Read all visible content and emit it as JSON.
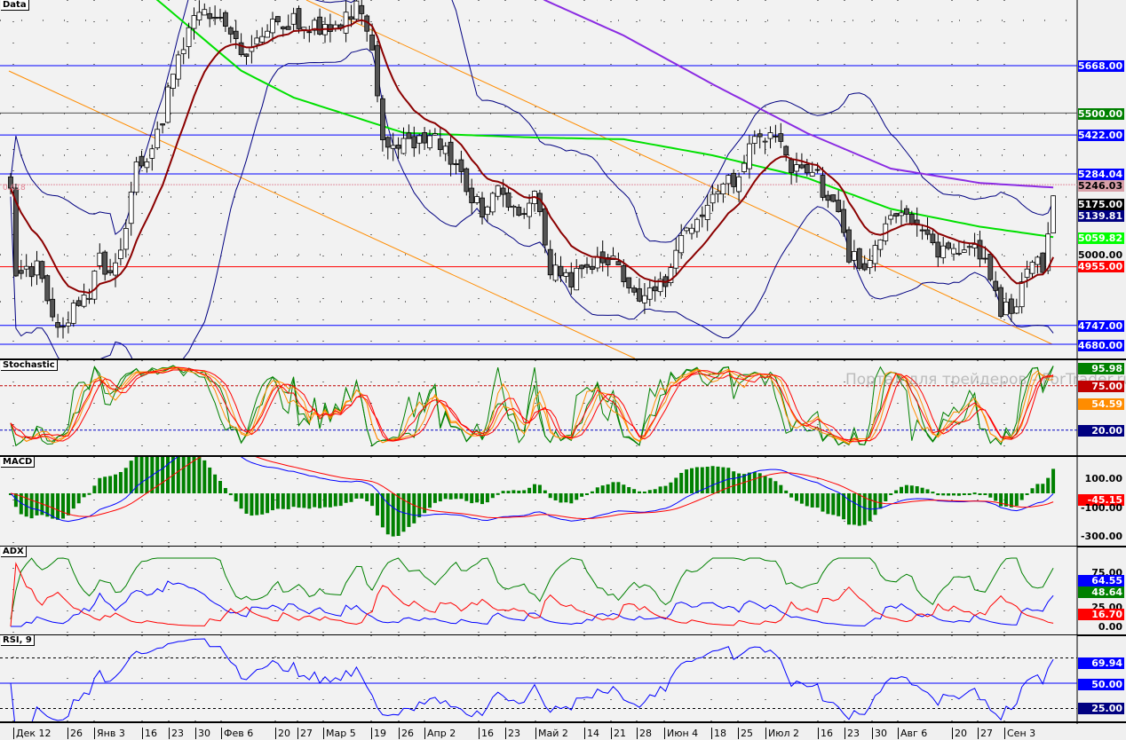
{
  "panels": {
    "main": "Data",
    "stoch": "Stochastic",
    "macd": "MACD",
    "adx": "ADX",
    "rsi": "RSI, 9"
  },
  "watermark": "Портал для трейдеров - ForTrader.ru",
  "fib_label": "0.618",
  "axis_labels": {
    "main": [
      {
        "text": "5668.00",
        "style": "blue"
      },
      {
        "text": "5500.00",
        "style": "green"
      },
      {
        "text": "5422.00",
        "style": "blue"
      },
      {
        "text": "5284.04",
        "style": "blue"
      },
      {
        "text": "5246.03",
        "style": "pink"
      },
      {
        "text": "5175.00",
        "style": "black"
      },
      {
        "text": "5139.81",
        "style": "navy"
      },
      {
        "text": "5059.82",
        "style": "lime"
      },
      {
        "text": "5000.00",
        "style": "plain"
      },
      {
        "text": "4955.00",
        "style": "red"
      },
      {
        "text": "4747.00",
        "style": "blue"
      },
      {
        "text": "4680.00",
        "style": "blue"
      }
    ],
    "stoch": [
      {
        "text": "95.98",
        "style": "green"
      },
      {
        "text": "75.00",
        "style": "dred"
      },
      {
        "text": "54.59",
        "style": "orange"
      },
      {
        "text": "20.00",
        "style": "navy"
      }
    ],
    "macd": [
      {
        "text": "100.00",
        "style": "plain"
      },
      {
        "text": "-45.15",
        "style": "red"
      },
      {
        "text": "-100.00",
        "style": "plain"
      },
      {
        "text": "-300.00",
        "style": "plain"
      }
    ],
    "adx": [
      {
        "text": "75.00",
        "style": "plain"
      },
      {
        "text": "64.55",
        "style": "blue"
      },
      {
        "text": "48.64",
        "style": "green"
      },
      {
        "text": "25.00",
        "style": "plain"
      },
      {
        "text": "16.70",
        "style": "red"
      },
      {
        "text": "0.00",
        "style": "plain"
      }
    ],
    "rsi": [
      {
        "text": "69.94",
        "style": "blue"
      },
      {
        "text": "50.00",
        "style": "blue"
      },
      {
        "text": "25.00",
        "style": "navy"
      }
    ]
  },
  "dates": [
    "Дек 12",
    "26",
    "Янв 3",
    "16",
    "23",
    "30",
    "Фев 6",
    "20",
    "27",
    "Мар 5",
    "19",
    "26",
    "Апр 2",
    "16",
    "23",
    "Май 2",
    "14",
    "21",
    "28",
    "Июн 4",
    "18",
    "25",
    "Июл 2",
    "16",
    "23",
    "30",
    "Авг 6",
    "20",
    "27",
    "Сен 3"
  ],
  "colors": {
    "ma_fast": "#8b0000",
    "ma_mid": "#00e000",
    "ma_slow": "#8a2be2",
    "bands": "#000080",
    "channel": "#ff8c00",
    "level": "#0000ff",
    "support_red": "#ff0000"
  },
  "chart_data": {
    "type": "candlestick",
    "title": "Data",
    "bars": 200,
    "close_keypoints": [
      [
        0,
        5200
      ],
      [
        1,
        4900
      ],
      [
        5,
        4950
      ],
      [
        9,
        4760
      ],
      [
        14,
        4830
      ],
      [
        17,
        4970
      ],
      [
        20,
        4950
      ],
      [
        24,
        5300
      ],
      [
        28,
        5420
      ],
      [
        32,
        5700
      ],
      [
        35,
        5820
      ],
      [
        39,
        5870
      ],
      [
        44,
        5700
      ],
      [
        49,
        5820
      ],
      [
        56,
        5830
      ],
      [
        61,
        5780
      ],
      [
        66,
        5880
      ],
      [
        69,
        5700
      ],
      [
        71,
        5400
      ],
      [
        75,
        5380
      ],
      [
        80,
        5440
      ],
      [
        85,
        5300
      ],
      [
        90,
        5150
      ],
      [
        93,
        5230
      ],
      [
        97,
        5120
      ],
      [
        100,
        5200
      ],
      [
        103,
        4950
      ],
      [
        107,
        4900
      ],
      [
        110,
        4950
      ],
      [
        115,
        4980
      ],
      [
        120,
        4810
      ],
      [
        125,
        4900
      ],
      [
        129,
        5100
      ],
      [
        132,
        5160
      ],
      [
        136,
        5250
      ],
      [
        139,
        5270
      ],
      [
        142,
        5420
      ],
      [
        146,
        5420
      ],
      [
        149,
        5310
      ],
      [
        154,
        5270
      ],
      [
        158,
        5120
      ],
      [
        160,
        4980
      ],
      [
        163,
        4970
      ],
      [
        166,
        5060
      ],
      [
        171,
        5170
      ],
      [
        176,
        5030
      ],
      [
        181,
        5000
      ],
      [
        186,
        5000
      ],
      [
        189,
        4800
      ],
      [
        192,
        4790
      ],
      [
        194,
        4960
      ],
      [
        197,
        4960
      ],
      [
        199,
        5175
      ]
    ],
    "ma_mid_keypoints": [
      [
        20,
        6050
      ],
      [
        28,
        5901
      ],
      [
        44,
        5650
      ],
      [
        54,
        5555
      ],
      [
        75,
        5430
      ],
      [
        100,
        5413
      ],
      [
        117,
        5407
      ],
      [
        134,
        5350
      ],
      [
        152,
        5270
      ],
      [
        168,
        5160
      ],
      [
        185,
        5097
      ],
      [
        199,
        5060
      ]
    ],
    "ma_slow_keypoints": [
      [
        95,
        5980
      ],
      [
        102,
        5900
      ],
      [
        117,
        5775
      ],
      [
        134,
        5602
      ],
      [
        152,
        5429
      ],
      [
        168,
        5303
      ],
      [
        185,
        5252
      ],
      [
        199,
        5236
      ]
    ],
    "levels": [
      5668,
      5500,
      5422,
      5284.04,
      4955,
      4747,
      4680
    ],
    "fib_level": 5246.03,
    "price_range": [
      4630,
      5901
    ],
    "stochastic": {
      "upper": 75,
      "lower": 20,
      "last": 95.98
    },
    "macd": {
      "last": -45.15
    },
    "adx": {
      "last_adx": 64.55,
      "last_plus": 48.64,
      "last_minus": 16.7
    },
    "rsi": {
      "period": 9,
      "last": 69.94,
      "levels": [
        25,
        50,
        75
      ]
    }
  }
}
